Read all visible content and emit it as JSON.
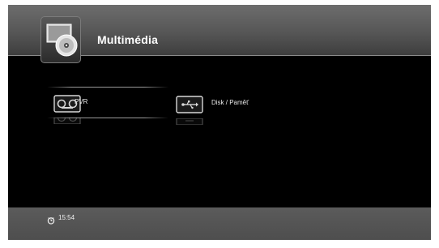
{
  "header": {
    "title": "Multimédia",
    "icon": "multimedia-disc-icon"
  },
  "menu": {
    "items": [
      {
        "label": "PVR",
        "icon": "cassette-icon",
        "selected": true
      },
      {
        "label": "Disk / Paměť",
        "icon": "usb-icon",
        "selected": false
      }
    ]
  },
  "footer": {
    "time": "15:54",
    "icon": "clock-icon"
  },
  "colors": {
    "background": "#000000",
    "header": "#5e5e5e",
    "footer": "#555555",
    "text": "#ffffff"
  }
}
